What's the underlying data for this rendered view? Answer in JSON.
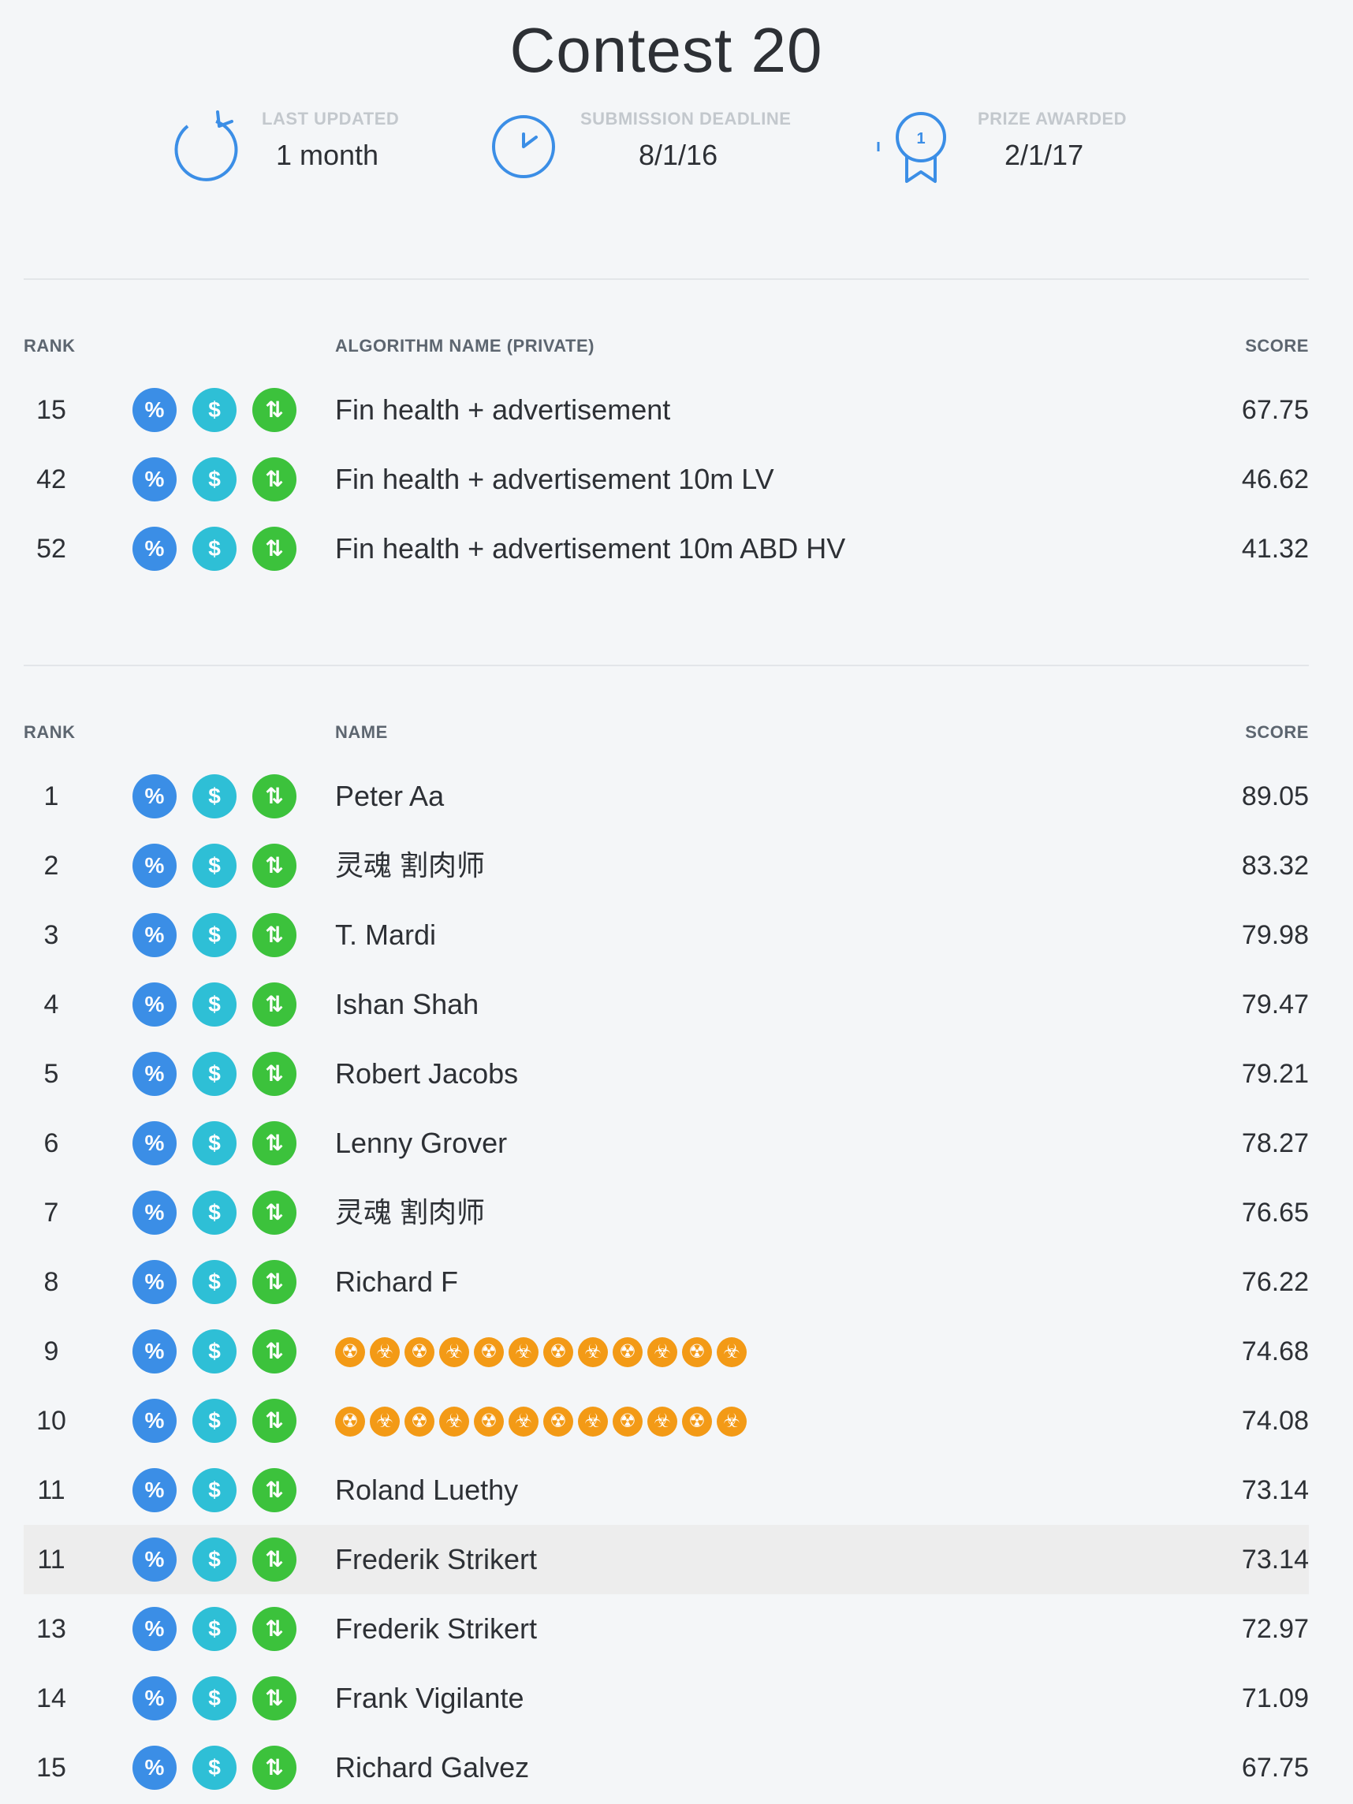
{
  "page": {
    "title": "Contest 20"
  },
  "stats": [
    {
      "label": "LAST UPDATED",
      "value": "1 month",
      "icon": "refresh-icon"
    },
    {
      "label": "SUBMISSION DEADLINE",
      "value": "8/1/16",
      "icon": "clock-icon"
    },
    {
      "label": "PRIZE AWARDED",
      "value": "2/1/17",
      "icon": "award-ribbon-icon",
      "badge_text": "1"
    }
  ],
  "colors": {
    "badge_blue": "#3b8ee6",
    "badge_cyan": "#2ebfd6",
    "badge_green": "#3cc23c",
    "emoji_orange": "#f39a16"
  },
  "algorithms": {
    "headers": {
      "rank": "RANK",
      "name": "ALGORITHM NAME (PRIVATE)",
      "score": "SCORE"
    },
    "rows": [
      {
        "rank": "15",
        "name": "Fin health + advertisement",
        "score": "67.75"
      },
      {
        "rank": "42",
        "name": "Fin health + advertisement 10m LV",
        "score": "46.62"
      },
      {
        "rank": "52",
        "name": "Fin health + advertisement 10m ABD HV",
        "score": "41.32"
      }
    ]
  },
  "leaderboard": {
    "headers": {
      "rank": "RANK",
      "name": "NAME",
      "score": "SCORE"
    },
    "rows": [
      {
        "rank": "1",
        "name": "Peter Aa",
        "score": "89.05"
      },
      {
        "rank": "2",
        "name": "灵魂 割肉师",
        "score": "83.32"
      },
      {
        "rank": "3",
        "name": "T. Mardi",
        "score": "79.98"
      },
      {
        "rank": "4",
        "name": "Ishan Shah",
        "score": "79.47"
      },
      {
        "rank": "5",
        "name": "Robert Jacobs",
        "score": "79.21"
      },
      {
        "rank": "6",
        "name": "Lenny Grover",
        "score": "78.27"
      },
      {
        "rank": "7",
        "name": "灵魂 割肉师",
        "score": "76.65"
      },
      {
        "rank": "8",
        "name": "Richard F",
        "score": "76.22"
      },
      {
        "rank": "9",
        "name": "☢☣☢☣☢☣☢☣☢☣☢☣",
        "score": "74.68",
        "emoji": true
      },
      {
        "rank": "10",
        "name": "☢☣☢☣☢☣☢☣☢☣☢☣",
        "score": "74.08",
        "emoji": true
      },
      {
        "rank": "11",
        "name": "Roland Luethy",
        "score": "73.14"
      },
      {
        "rank": "11",
        "name": "Frederik Strikert",
        "score": "73.14",
        "highlighted": true
      },
      {
        "rank": "13",
        "name": "Frederik Strikert",
        "score": "72.97"
      },
      {
        "rank": "14",
        "name": "Frank Vigilante",
        "score": "71.09"
      },
      {
        "rank": "15",
        "name": "Richard Galvez",
        "score": "67.75"
      }
    ]
  }
}
